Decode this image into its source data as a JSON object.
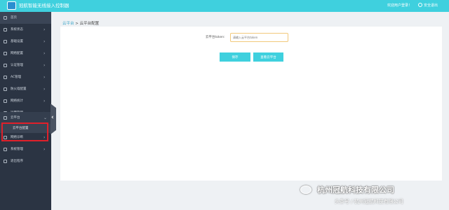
{
  "header": {
    "app_title": "冠航智能无线接入控制器",
    "welcome_text": "欢迎用户登录！",
    "logout_label": "安全退出",
    "logo_icon": "app-logo-icon",
    "logout_icon": "power-icon"
  },
  "sidebar": {
    "items": [
      {
        "label": "首页",
        "icon": "home-icon"
      },
      {
        "label": "系统状态",
        "icon": "status-icon"
      },
      {
        "label": "基础设置",
        "icon": "settings-icon"
      },
      {
        "label": "网络配置",
        "icon": "network-icon"
      },
      {
        "label": "认证管理",
        "icon": "auth-icon"
      },
      {
        "label": "AC管理",
        "icon": "ac-icon"
      },
      {
        "label": "防火墙配置",
        "icon": "firewall-icon"
      },
      {
        "label": "网络统计",
        "icon": "stats-icon"
      },
      {
        "label": "运营管理",
        "icon": "operation-icon"
      },
      {
        "label": "云平台",
        "icon": "cloud-icon"
      },
      {
        "label": "网络诊断",
        "icon": "diagnose-icon"
      },
      {
        "label": "系统管理",
        "icon": "system-icon"
      },
      {
        "label": "退出程序",
        "icon": "exit-icon"
      }
    ],
    "submenu": {
      "label": "云平台配置"
    }
  },
  "breadcrumb": {
    "first": "云平台",
    "separator": " > ",
    "current": "云平台配置"
  },
  "form": {
    "label": "云平台token:",
    "placeholder": "请输入云平台token",
    "save_button": "保存",
    "view_button": "查看云平台"
  },
  "watermark": {
    "line1": "杭州冠航科技有限公司",
    "line2": "头条号 / 杭州冠航科技有限公司"
  },
  "colors": {
    "accent": "#3fd0de",
    "sidebar_bg": "#2b3443",
    "highlight": "#e0202a"
  }
}
